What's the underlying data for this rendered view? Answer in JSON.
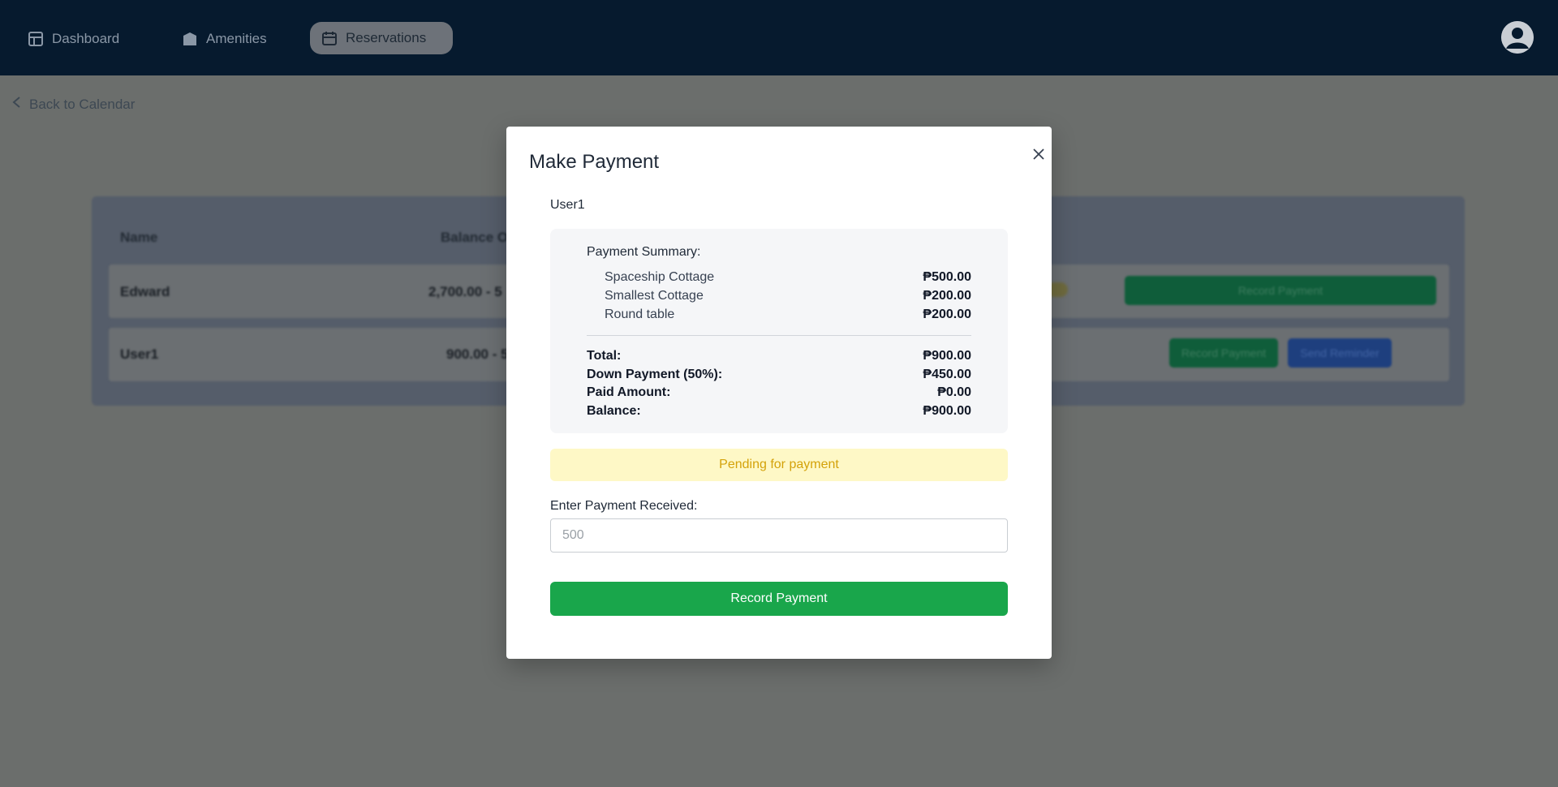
{
  "nav": {
    "items": [
      {
        "label": "Dashboard",
        "icon": "grid-icon"
      },
      {
        "label": "Amenities",
        "icon": "building-icon"
      },
      {
        "label": "Reservations",
        "icon": "calendar-icon"
      }
    ],
    "active": "Reservations"
  },
  "page": {
    "back_link": "Back to Calendar"
  },
  "table": {
    "headers": [
      "Name",
      "Balance O"
    ],
    "rows": [
      {
        "name": "Edward",
        "balance": "2,700.00 - 5",
        "actions": [
          "Record Payment"
        ]
      },
      {
        "name": "User1",
        "balance": "900.00 - 5",
        "actions": [
          "Record Payment",
          "Send Reminder"
        ]
      }
    ]
  },
  "modal": {
    "title": "Make Payment",
    "user": "User1",
    "summary_heading": "Payment Summary:",
    "items": [
      {
        "name": "Spaceship Cottage",
        "amount": "₱500.00"
      },
      {
        "name": "Smallest Cottage",
        "amount": "₱200.00"
      },
      {
        "name": "Round table",
        "amount": "₱200.00"
      }
    ],
    "totals": [
      {
        "label": "Total:",
        "value": "₱900.00"
      },
      {
        "label": "Down Payment (50%):",
        "value": "₱450.00"
      },
      {
        "label": "Paid Amount:",
        "value": "₱0.00"
      },
      {
        "label": "Balance:",
        "value": "₱900.00"
      }
    ],
    "status": "Pending for payment",
    "input_label": "Enter Payment Received:",
    "input_placeholder": "500",
    "submit_label": "Record Payment"
  },
  "colors": {
    "navbar": "#061a2e",
    "overlay": "#6b6e6c",
    "record_button": "#19a64b",
    "status_bg": "#fef8c6",
    "status_text": "#d4a20a"
  }
}
